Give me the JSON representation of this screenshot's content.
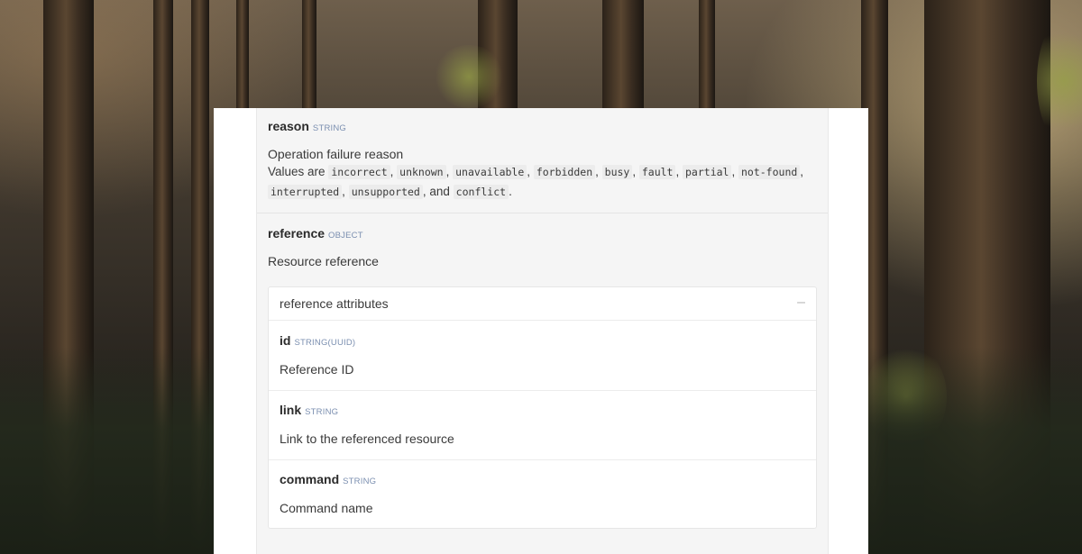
{
  "reason": {
    "name": "reason",
    "type": "STRING",
    "description": "Operation failure reason",
    "values_prefix": "Values are",
    "values": [
      "incorrect",
      "unknown",
      "unavailable",
      "forbidden",
      "busy",
      "fault",
      "partial",
      "not-found",
      "interrupted",
      "unsupported"
    ],
    "values_and": "and",
    "values_last": "conflict"
  },
  "reference": {
    "name": "reference",
    "type": "OBJECT",
    "description": "Resource reference",
    "attributes_title": "reference attributes",
    "collapse_symbol": "–",
    "attributes": [
      {
        "name": "id",
        "type": "STRING(UUID)",
        "description": "Reference ID"
      },
      {
        "name": "link",
        "type": "STRING",
        "description": "Link to the referenced resource"
      },
      {
        "name": "command",
        "type": "STRING",
        "description": "Command name"
      }
    ]
  }
}
